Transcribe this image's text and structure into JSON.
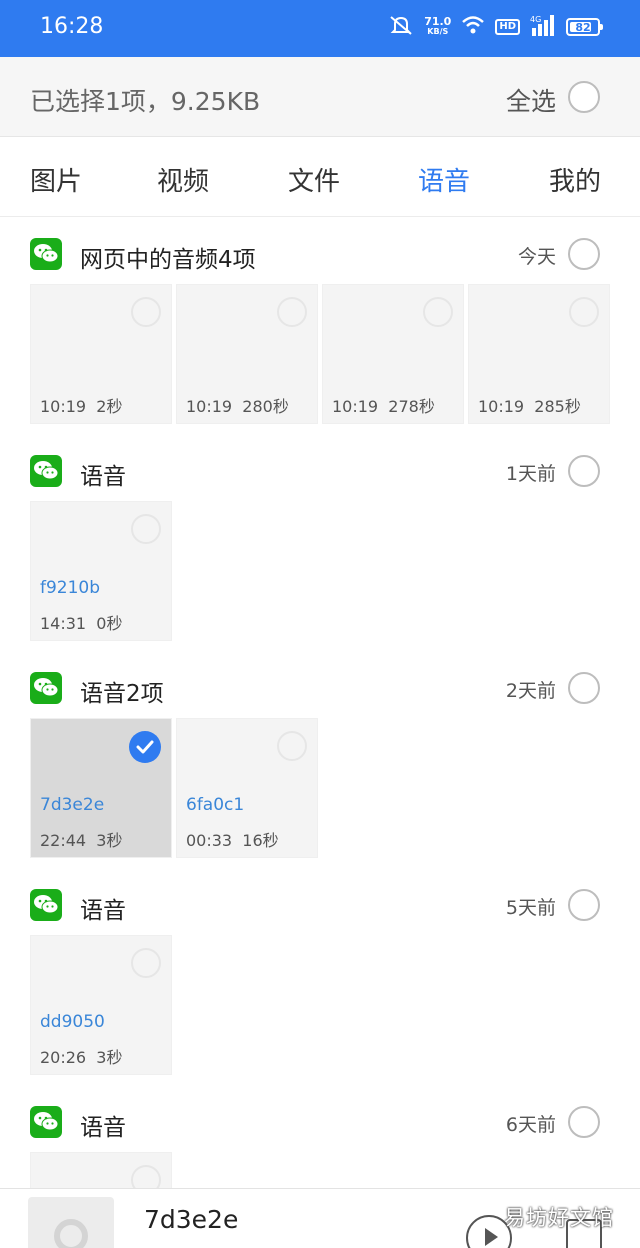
{
  "status_bar": {
    "time": "16:28",
    "speed_value": "71.0",
    "speed_unit": "KB/S",
    "hd": "HD",
    "network": "4G",
    "battery": "82",
    "icons": [
      "mute-bell-icon",
      "wifi-icon",
      "hd-icon",
      "signal-icon",
      "battery-icon"
    ]
  },
  "selection": {
    "summary": "已选择1项，9.25KB",
    "select_all": "全选"
  },
  "tabs": [
    {
      "label": "图片",
      "active": false
    },
    {
      "label": "视频",
      "active": false
    },
    {
      "label": "文件",
      "active": false
    },
    {
      "label": "语音",
      "active": true
    },
    {
      "label": "我的",
      "active": false
    }
  ],
  "groups": [
    {
      "title": "网页中的音频4项",
      "date": "今天",
      "items": [
        {
          "time": "10:19",
          "duration": "2秒"
        },
        {
          "time": "10:19",
          "duration": "280秒"
        },
        {
          "time": "10:19",
          "duration": "278秒"
        },
        {
          "time": "10:19",
          "duration": "285秒"
        }
      ]
    },
    {
      "title": "语音",
      "date": "1天前",
      "items": [
        {
          "name": "f9210b",
          "time": "14:31",
          "duration": "0秒"
        }
      ]
    },
    {
      "title": "语音2项",
      "date": "2天前",
      "items": [
        {
          "name": "7d3e2e",
          "time": "22:44",
          "duration": "3秒",
          "selected": true
        },
        {
          "name": "6fa0c1",
          "time": "00:33",
          "duration": "16秒"
        }
      ]
    },
    {
      "title": "语音",
      "date": "5天前",
      "items": [
        {
          "name": "dd9050",
          "time": "20:26",
          "duration": "3秒"
        }
      ]
    },
    {
      "title": "语音",
      "date": "6天前",
      "items": []
    }
  ],
  "player": {
    "name": "7d3e2e"
  },
  "watermark": "易坊好文馆",
  "colors": {
    "accent": "#2f7bf0",
    "wechat_green": "#1aad19",
    "link_blue": "#3a86d8"
  }
}
